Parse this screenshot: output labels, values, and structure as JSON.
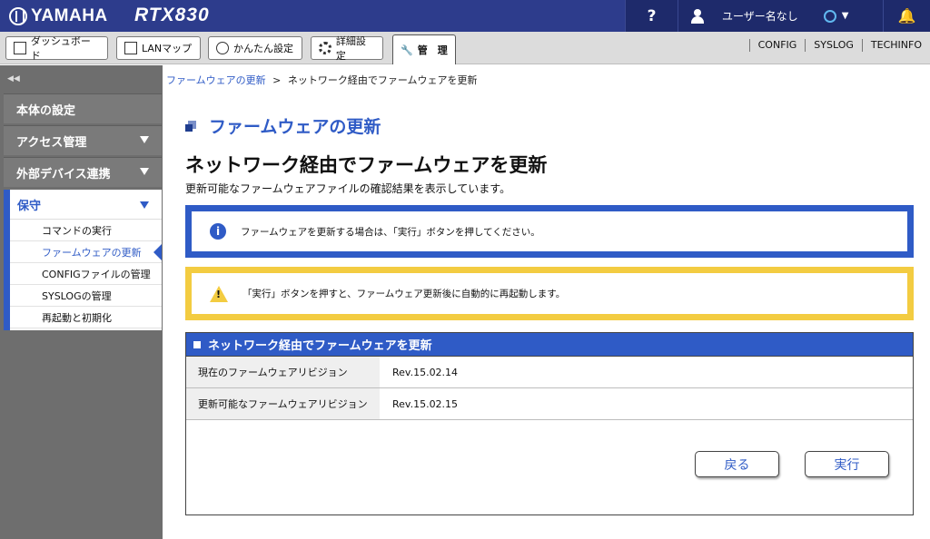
{
  "header": {
    "brand": "YAMAHA",
    "model": "RTX830",
    "help_label": "?",
    "username": "ユーザー名なし",
    "brand_color": "#2d3c8c"
  },
  "tabs": [
    {
      "label": "ダッシュボード",
      "icon": "dashboard-icon"
    },
    {
      "label": "LANマップ",
      "icon": "lan-map-icon"
    },
    {
      "label": "かんたん設定",
      "icon": "wizard-icon"
    },
    {
      "label": "詳細設定",
      "icon": "gear-icon"
    },
    {
      "label": "管　理",
      "icon": "wrench-icon",
      "active": true
    }
  ],
  "top_links": [
    "CONFIG",
    "SYSLOG",
    "TECHINFO"
  ],
  "sidebar": {
    "collapse_label": "◀◀",
    "items": [
      {
        "label": "本体の設定"
      },
      {
        "label": "アクセス管理"
      },
      {
        "label": "外部デバイス連携"
      }
    ],
    "active_group": {
      "label": "保守",
      "subitems": [
        {
          "label": "コマンドの実行"
        },
        {
          "label": "ファームウェアの更新",
          "current": true
        },
        {
          "label": "CONFIGファイルの管理"
        },
        {
          "label": "SYSLOGの管理"
        },
        {
          "label": "再起動と初期化"
        }
      ]
    }
  },
  "breadcrumb": {
    "parent": "ファームウェアの更新",
    "separator": ">",
    "current": "ネットワーク経由でファームウェアを更新"
  },
  "main": {
    "section_title": "ファームウェアの更新",
    "page_title": "ネットワーク経由でファームウェアを更新",
    "description": "更新可能なファームウェアファイルの確認結果を表示しています。",
    "info_notice": "ファームウェアを更新する場合は、「実行」ボタンを押してください。",
    "warning_notice": "「実行」ボタンを押すと、ファームウェア更新後に自動的に再起動します。",
    "panel_title": "ネットワーク経由でファームウェアを更新",
    "rows": [
      {
        "label": "現在のファームウェアリビジョン",
        "value": "Rev.15.02.14"
      },
      {
        "label": "更新可能なファームウェアリビジョン",
        "value": "Rev.15.02.15"
      }
    ],
    "back_button": "戻る",
    "execute_button": "実行"
  },
  "colors": {
    "accent": "#2f5bc6",
    "warning": "#f3cc41",
    "sidebar": "#6e6e6e"
  }
}
